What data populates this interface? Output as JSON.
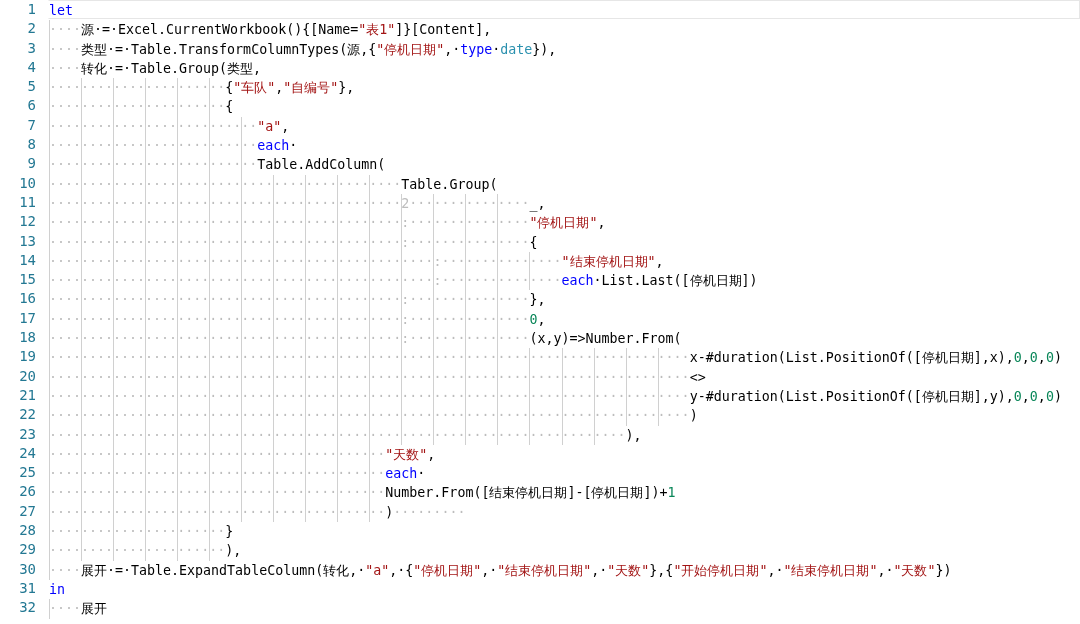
{
  "lines": [
    {
      "number": "1",
      "current": true,
      "tokens": [
        {
          "kind": "k",
          "text": "let"
        }
      ]
    },
    {
      "number": "2",
      "current": false,
      "tokens": [
        {
          "kind": "w",
          "text": "····"
        },
        {
          "kind": "p",
          "text": "源·=·Excel.CurrentWorkbook(){[Name="
        },
        {
          "kind": "s",
          "text": "\"表1\""
        },
        {
          "kind": "p",
          "text": "]}[Content],"
        }
      ]
    },
    {
      "number": "3",
      "current": false,
      "tokens": [
        {
          "kind": "w",
          "text": "····"
        },
        {
          "kind": "p",
          "text": "类型·=·Table.TransformColumnTypes(源,{"
        },
        {
          "kind": "s",
          "text": "\"停机日期\""
        },
        {
          "kind": "p",
          "text": ",·"
        },
        {
          "kind": "k",
          "text": "type"
        },
        {
          "kind": "p",
          "text": "·"
        },
        {
          "kind": "t",
          "text": "date"
        },
        {
          "kind": "p",
          "text": "}),"
        }
      ]
    },
    {
      "number": "4",
      "current": false,
      "tokens": [
        {
          "kind": "w",
          "text": "····"
        },
        {
          "kind": "p",
          "text": "转化·=·Table.Group(类型,"
        }
      ]
    },
    {
      "number": "5",
      "current": false,
      "tokens": [
        {
          "kind": "w",
          "text": "······················"
        },
        {
          "kind": "p",
          "text": "{"
        },
        {
          "kind": "s",
          "text": "\"车队\""
        },
        {
          "kind": "p",
          "text": ","
        },
        {
          "kind": "s",
          "text": "\"自编号\""
        },
        {
          "kind": "p",
          "text": "},"
        }
      ]
    },
    {
      "number": "6",
      "current": false,
      "tokens": [
        {
          "kind": "w",
          "text": "······················"
        },
        {
          "kind": "p",
          "text": "{"
        }
      ]
    },
    {
      "number": "7",
      "current": false,
      "tokens": [
        {
          "kind": "w",
          "text": "··························"
        },
        {
          "kind": "s",
          "text": "\"a\""
        },
        {
          "kind": "p",
          "text": ","
        }
      ]
    },
    {
      "number": "8",
      "current": false,
      "tokens": [
        {
          "kind": "w",
          "text": "··························"
        },
        {
          "kind": "k",
          "text": "each"
        },
        {
          "kind": "p",
          "text": "·"
        }
      ]
    },
    {
      "number": "9",
      "current": false,
      "tokens": [
        {
          "kind": "w",
          "text": "··························"
        },
        {
          "kind": "p",
          "text": "Table.AddColumn("
        }
      ]
    },
    {
      "number": "10",
      "current": false,
      "tokens": [
        {
          "kind": "w",
          "text": "············································"
        },
        {
          "kind": "p",
          "text": "Table.Group("
        }
      ]
    },
    {
      "number": "11",
      "current": false,
      "tokens": [
        {
          "kind": "w",
          "text": "············································2···············"
        },
        {
          "kind": "p",
          "text": "_,"
        }
      ]
    },
    {
      "number": "12",
      "current": false,
      "tokens": [
        {
          "kind": "w",
          "text": "············································:···············"
        },
        {
          "kind": "s",
          "text": "\"停机日期\""
        },
        {
          "kind": "p",
          "text": ","
        }
      ]
    },
    {
      "number": "13",
      "current": false,
      "tokens": [
        {
          "kind": "w",
          "text": "············································:···············"
        },
        {
          "kind": "p",
          "text": "{"
        }
      ]
    },
    {
      "number": "14",
      "current": false,
      "tokens": [
        {
          "kind": "w",
          "text": "················································:···············"
        },
        {
          "kind": "s",
          "text": "\"结束停机日期\""
        },
        {
          "kind": "p",
          "text": ","
        }
      ]
    },
    {
      "number": "15",
      "current": false,
      "tokens": [
        {
          "kind": "w",
          "text": "················································:···············"
        },
        {
          "kind": "k",
          "text": "each"
        },
        {
          "kind": "p",
          "text": "·List.Last([停机日期])"
        }
      ]
    },
    {
      "number": "16",
      "current": false,
      "tokens": [
        {
          "kind": "w",
          "text": "············································:···············"
        },
        {
          "kind": "p",
          "text": "},"
        }
      ]
    },
    {
      "number": "17",
      "current": false,
      "tokens": [
        {
          "kind": "w",
          "text": "············································:···············"
        },
        {
          "kind": "n",
          "text": "0"
        },
        {
          "kind": "p",
          "text": ","
        }
      ]
    },
    {
      "number": "18",
      "current": false,
      "tokens": [
        {
          "kind": "w",
          "text": "············································:···············"
        },
        {
          "kind": "p",
          "text": "(x,y)=>Number.From("
        }
      ]
    },
    {
      "number": "19",
      "current": false,
      "tokens": [
        {
          "kind": "w",
          "text": "················································································"
        },
        {
          "kind": "p",
          "text": "x-#duration(List.PositionOf([停机日期],x),"
        },
        {
          "kind": "n",
          "text": "0"
        },
        {
          "kind": "p",
          "text": ","
        },
        {
          "kind": "n",
          "text": "0"
        },
        {
          "kind": "p",
          "text": ","
        },
        {
          "kind": "n",
          "text": "0"
        },
        {
          "kind": "p",
          "text": ")"
        }
      ]
    },
    {
      "number": "20",
      "current": false,
      "tokens": [
        {
          "kind": "w",
          "text": "················································································"
        },
        {
          "kind": "p",
          "text": "<>"
        }
      ]
    },
    {
      "number": "21",
      "current": false,
      "tokens": [
        {
          "kind": "w",
          "text": "················································································"
        },
        {
          "kind": "p",
          "text": "y-#duration(List.PositionOf([停机日期],y),"
        },
        {
          "kind": "n",
          "text": "0"
        },
        {
          "kind": "p",
          "text": ","
        },
        {
          "kind": "n",
          "text": "0"
        },
        {
          "kind": "p",
          "text": ","
        },
        {
          "kind": "n",
          "text": "0"
        },
        {
          "kind": "p",
          "text": ")"
        }
      ]
    },
    {
      "number": "22",
      "current": false,
      "tokens": [
        {
          "kind": "w",
          "text": "················································································"
        },
        {
          "kind": "p",
          "text": ")"
        }
      ]
    },
    {
      "number": "23",
      "current": false,
      "tokens": [
        {
          "kind": "w",
          "text": "········································································"
        },
        {
          "kind": "p",
          "text": "),"
        }
      ]
    },
    {
      "number": "24",
      "current": false,
      "tokens": [
        {
          "kind": "w",
          "text": "··········································"
        },
        {
          "kind": "s",
          "text": "\"天数\""
        },
        {
          "kind": "p",
          "text": ","
        }
      ]
    },
    {
      "number": "25",
      "current": false,
      "tokens": [
        {
          "kind": "w",
          "text": "··········································"
        },
        {
          "kind": "k",
          "text": "each"
        },
        {
          "kind": "p",
          "text": "·"
        }
      ]
    },
    {
      "number": "26",
      "current": false,
      "tokens": [
        {
          "kind": "w",
          "text": "··········································"
        },
        {
          "kind": "p",
          "text": "Number.From([结束停机日期]-[停机日期])+"
        },
        {
          "kind": "n",
          "text": "1"
        }
      ]
    },
    {
      "number": "27",
      "current": false,
      "tokens": [
        {
          "kind": "w",
          "text": "··········································"
        },
        {
          "kind": "p",
          "text": ")"
        },
        {
          "kind": "w",
          "text": "·········"
        }
      ]
    },
    {
      "number": "28",
      "current": false,
      "tokens": [
        {
          "kind": "w",
          "text": "······················"
        },
        {
          "kind": "p",
          "text": "}"
        }
      ]
    },
    {
      "number": "29",
      "current": false,
      "tokens": [
        {
          "kind": "w",
          "text": "······················"
        },
        {
          "kind": "p",
          "text": "),"
        }
      ]
    },
    {
      "number": "30",
      "current": false,
      "tokens": [
        {
          "kind": "w",
          "text": "····"
        },
        {
          "kind": "p",
          "text": "展开·=·Table.ExpandTableColumn(转化,·"
        },
        {
          "kind": "s",
          "text": "\"a\""
        },
        {
          "kind": "p",
          "text": ",·{"
        },
        {
          "kind": "s",
          "text": "\"停机日期\""
        },
        {
          "kind": "p",
          "text": ",·"
        },
        {
          "kind": "s",
          "text": "\"结束停机日期\""
        },
        {
          "kind": "p",
          "text": ",·"
        },
        {
          "kind": "s",
          "text": "\"天数\""
        },
        {
          "kind": "p",
          "text": "},{"
        },
        {
          "kind": "s",
          "text": "\"开始停机日期\""
        },
        {
          "kind": "p",
          "text": ",·"
        },
        {
          "kind": "s",
          "text": "\"结束停机日期\""
        },
        {
          "kind": "p",
          "text": ",·"
        },
        {
          "kind": "s",
          "text": "\"天数\""
        },
        {
          "kind": "p",
          "text": "})"
        }
      ]
    },
    {
      "number": "31",
      "current": false,
      "tokens": [
        {
          "kind": "k",
          "text": "in"
        }
      ]
    },
    {
      "number": "32",
      "current": false,
      "tokens": [
        {
          "kind": "w",
          "text": "····"
        },
        {
          "kind": "p",
          "text": "展开"
        }
      ]
    }
  ]
}
